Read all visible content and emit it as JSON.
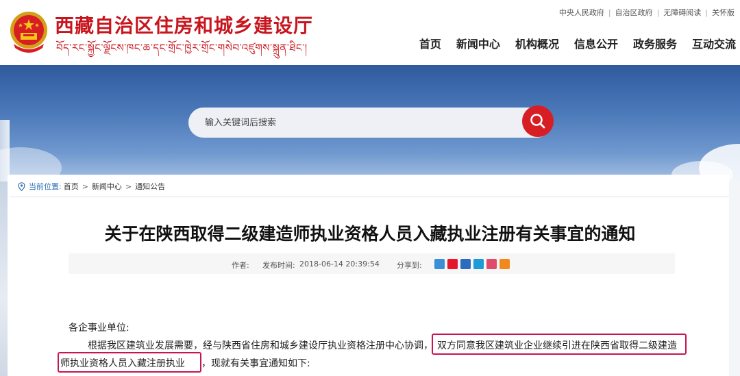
{
  "header": {
    "title": "西藏自治区住房和城乡建设厅",
    "title_tibetan": "བོད་རང་སྐྱོང་ལྗོངས་ཁང་ཆ་དང་གྲོང་ཁྱེར་གྲོང་གསེབ་འཛུགས་སྐྲུན་ཐིང་།",
    "top_links": [
      "中央人民政府",
      "自治区政府",
      "无障碍阅读",
      "关怀版"
    ],
    "nav": [
      "首页",
      "新闻中心",
      "机构概况",
      "信息公开",
      "政务服务",
      "互动交流"
    ]
  },
  "search": {
    "placeholder": "输入关键词后搜索",
    "icon": "search-icon"
  },
  "breadcrumb": {
    "label": "当前位置:",
    "items": [
      "首页",
      "新闻中心",
      "通知公告"
    ],
    "separator": ">"
  },
  "article": {
    "title": "关于在陕西取得二级建造师执业资格人员入藏执业注册有关事宜的通知",
    "author_label": "作者:",
    "date_label": "发布时间:",
    "date": "2018-06-14 20:39:54",
    "share_label": "分享到:",
    "salutation": "各企事业单位:",
    "p1_part1": "根据我区建筑业发展需要，经与陕西省住房和城乡建设厅执业资格注册中心协调，",
    "p1_highlight1": "双方同意我区建筑业企业继续引进在陕西省取得二级建造",
    "p1_highlight2": "师执业资格人员入藏注册执业",
    "p1_part2": "，现就有关事宜通知如下:"
  },
  "colors": {
    "brand_red": "#c8151d",
    "highlight_border": "#c8154f",
    "link_blue": "#2f6fb5"
  }
}
